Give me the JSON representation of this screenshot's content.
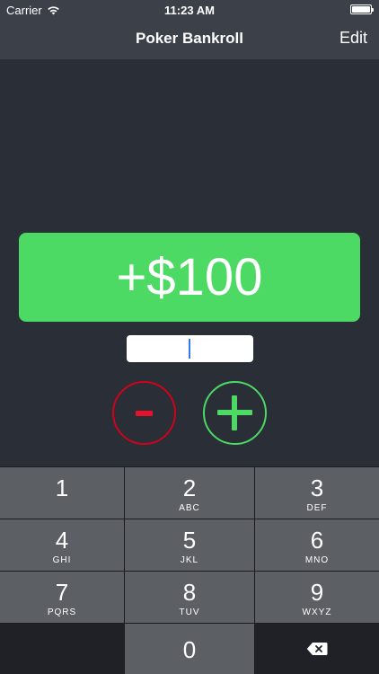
{
  "status_bar": {
    "carrier": "Carrier",
    "time": "11:23 AM"
  },
  "nav": {
    "title": "Poker Bankroll",
    "edit_label": "Edit"
  },
  "amount": {
    "display": "+$100",
    "input_value": "",
    "color": "#4cd964"
  },
  "buttons": {
    "minus_color": "#d0021b",
    "plus_color": "#4cd964"
  },
  "keypad": {
    "keys": [
      {
        "digit": "1",
        "letters": ""
      },
      {
        "digit": "2",
        "letters": "ABC"
      },
      {
        "digit": "3",
        "letters": "DEF"
      },
      {
        "digit": "4",
        "letters": "GHI"
      },
      {
        "digit": "5",
        "letters": "JKL"
      },
      {
        "digit": "6",
        "letters": "MNO"
      },
      {
        "digit": "7",
        "letters": "PQRS"
      },
      {
        "digit": "8",
        "letters": "TUV"
      },
      {
        "digit": "9",
        "letters": "WXYZ"
      },
      {
        "digit": "0",
        "letters": ""
      }
    ]
  }
}
